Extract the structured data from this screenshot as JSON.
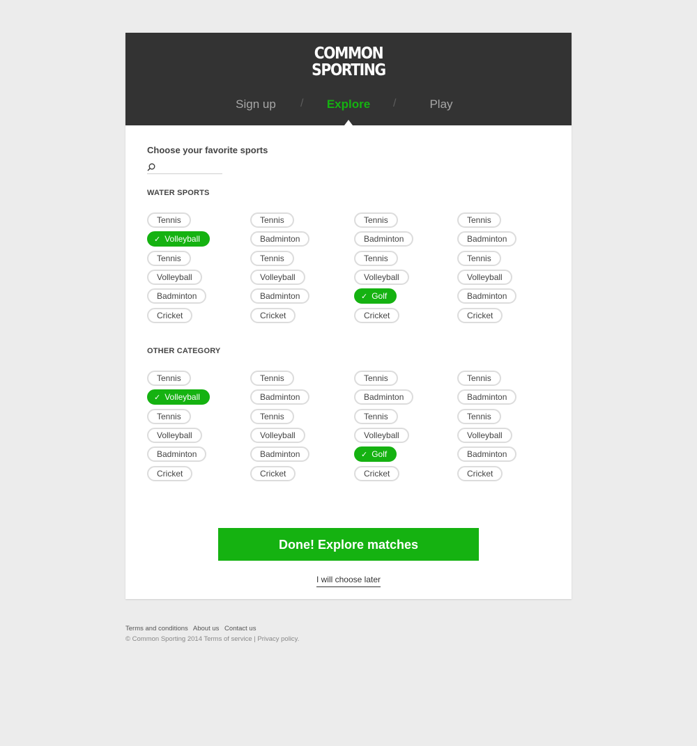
{
  "logo": {
    "line1": "COMMON",
    "line2": "SPORTING"
  },
  "steps": [
    {
      "label": "Sign up",
      "active": false
    },
    {
      "label": "Explore",
      "active": true
    },
    {
      "label": "Play",
      "active": false
    }
  ],
  "step_separator": "/",
  "choose_title": "Choose your favorite sports",
  "search": {
    "placeholder": "",
    "value": ""
  },
  "sections": [
    {
      "title": "WATER SPORTS",
      "columns": [
        [
          {
            "label": "Tennis",
            "selected": false
          },
          {
            "label": "Volleyball",
            "selected": true
          },
          {
            "label": "Tennis",
            "selected": false
          },
          {
            "label": "Volleyball",
            "selected": false
          },
          {
            "label": "Badminton",
            "selected": false
          },
          {
            "label": "Cricket",
            "selected": false
          }
        ],
        [
          {
            "label": "Tennis",
            "selected": false
          },
          {
            "label": "Badminton",
            "selected": false
          },
          {
            "label": "Tennis",
            "selected": false
          },
          {
            "label": "Volleyball",
            "selected": false
          },
          {
            "label": "Badminton",
            "selected": false
          },
          {
            "label": "Cricket",
            "selected": false
          }
        ],
        [
          {
            "label": "Tennis",
            "selected": false
          },
          {
            "label": "Badminton",
            "selected": false
          },
          {
            "label": "Tennis",
            "selected": false
          },
          {
            "label": "Volleyball",
            "selected": false
          },
          {
            "label": "Golf",
            "selected": true
          },
          {
            "label": "Cricket",
            "selected": false
          }
        ],
        [
          {
            "label": "Tennis",
            "selected": false
          },
          {
            "label": "Badminton",
            "selected": false
          },
          {
            "label": "Tennis",
            "selected": false
          },
          {
            "label": "Volleyball",
            "selected": false
          },
          {
            "label": "Badminton",
            "selected": false
          },
          {
            "label": "Cricket",
            "selected": false
          }
        ]
      ]
    },
    {
      "title": "OTHER CATEGORY",
      "columns": [
        [
          {
            "label": "Tennis",
            "selected": false
          },
          {
            "label": "Volleyball",
            "selected": true
          },
          {
            "label": "Tennis",
            "selected": false
          },
          {
            "label": "Volleyball",
            "selected": false
          },
          {
            "label": "Badminton",
            "selected": false
          },
          {
            "label": "Cricket",
            "selected": false
          }
        ],
        [
          {
            "label": "Tennis",
            "selected": false
          },
          {
            "label": "Badminton",
            "selected": false
          },
          {
            "label": "Tennis",
            "selected": false
          },
          {
            "label": "Volleyball",
            "selected": false
          },
          {
            "label": "Badminton",
            "selected": false
          },
          {
            "label": "Cricket",
            "selected": false
          }
        ],
        [
          {
            "label": "Tennis",
            "selected": false
          },
          {
            "label": "Badminton",
            "selected": false
          },
          {
            "label": "Tennis",
            "selected": false
          },
          {
            "label": "Volleyball",
            "selected": false
          },
          {
            "label": "Golf",
            "selected": true
          },
          {
            "label": "Cricket",
            "selected": false
          }
        ],
        [
          {
            "label": "Tennis",
            "selected": false
          },
          {
            "label": "Badminton",
            "selected": false
          },
          {
            "label": "Tennis",
            "selected": false
          },
          {
            "label": "Volleyball",
            "selected": false
          },
          {
            "label": "Badminton",
            "selected": false
          },
          {
            "label": "Cricket",
            "selected": false
          }
        ]
      ]
    }
  ],
  "check_glyph": "✓",
  "done_button": "Done! Explore matches",
  "later_link": "I will choose later",
  "footer": {
    "links": [
      "Terms and conditions",
      "About us",
      "Contact us"
    ],
    "copyright": "© Common Sporting 2014",
    "terms_of_service": "Terms of service",
    "divider": "|",
    "privacy_policy": "Privacy policy."
  },
  "colors": {
    "accent": "#15b211",
    "header_bg": "#333333",
    "page_bg": "#ececec"
  },
  "icons": {
    "search": "search-icon",
    "check": "check-icon"
  }
}
